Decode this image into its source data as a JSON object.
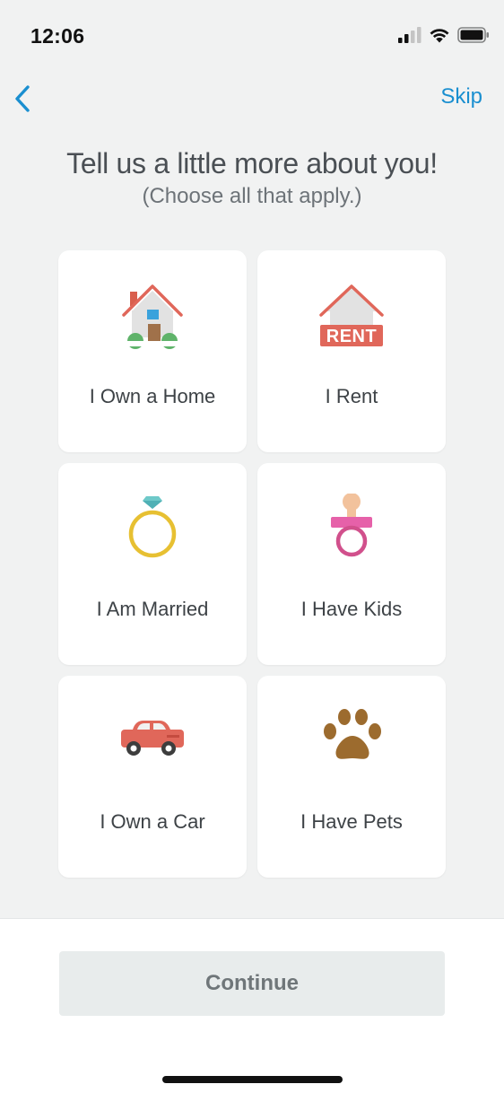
{
  "status_bar": {
    "time": "12:06"
  },
  "nav": {
    "skip_label": "Skip"
  },
  "heading": "Tell us a little more about you!",
  "subheading": "(Choose all that apply.)",
  "options": [
    {
      "label": "I Own a Home",
      "icon": "house-icon"
    },
    {
      "label": "I Rent",
      "icon": "rent-house-icon",
      "icon_text": "RENT"
    },
    {
      "label": "I Am Married",
      "icon": "ring-icon"
    },
    {
      "label": "I Have Kids",
      "icon": "pacifier-icon"
    },
    {
      "label": "I Own a Car",
      "icon": "car-icon"
    },
    {
      "label": "I Have Pets",
      "icon": "paw-icon"
    }
  ],
  "continue_label": "Continue",
  "colors": {
    "accent": "#1a8fd0",
    "background": "#f1f2f2",
    "card": "#ffffff",
    "button_disabled": "#e8ecec"
  }
}
